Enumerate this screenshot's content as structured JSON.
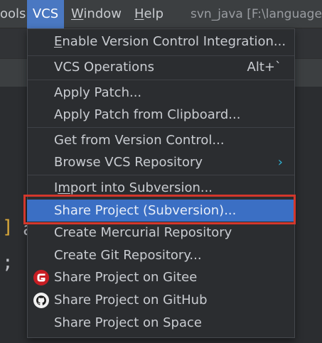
{
  "menubar": {
    "tools_partial": "ools",
    "vcs": "VCS",
    "window": "Window",
    "help": "Help",
    "project_title": "svn_java [F:\\languages"
  },
  "editor_fragments": {
    "bracket": "]",
    "letter": "a",
    "semicolon": ";"
  },
  "vcs_menu": {
    "items": [
      {
        "label": "Enable Version Control Integration..."
      },
      {
        "label": "VCS Operations",
        "shortcut": "Alt+`"
      },
      {
        "label": "Apply Patch..."
      },
      {
        "label": "Apply Patch from Clipboard..."
      },
      {
        "label": "Get from Version Control..."
      },
      {
        "label": "Browse VCS Repository"
      },
      {
        "label": "Import into Subversion..."
      },
      {
        "label": "Share Project (Subversion)..."
      },
      {
        "label": "Create Mercurial Repository"
      },
      {
        "label": "Create Git Repository..."
      },
      {
        "label": "Share Project on Gitee",
        "icon": "gitee-icon"
      },
      {
        "label": "Share Project on GitHub",
        "icon": "github-icon"
      },
      {
        "label": "Share Project on Space"
      }
    ],
    "highlighted_item": "Share Project (Subversion)...",
    "colors": {
      "highlight": "#3b6fc4",
      "annotation_box": "#d3372c",
      "gitee": "#c71d23",
      "submenu_arrow": "#2fb5d6"
    }
  }
}
